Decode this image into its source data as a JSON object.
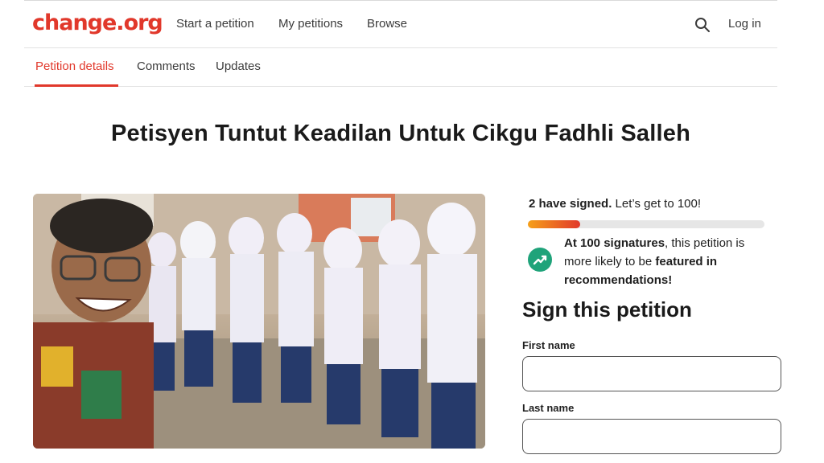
{
  "header": {
    "logo": "change.org",
    "nav": [
      "Start a petition",
      "My petitions",
      "Browse"
    ],
    "login": "Log in"
  },
  "tabs": {
    "items": [
      "Petition details",
      "Comments",
      "Updates"
    ],
    "active": "Petition details"
  },
  "petition": {
    "title": "Petisyen Tuntut Keadilan Untuk Cikgu Fadhli Salleh"
  },
  "signatures": {
    "count_text": "2 have signed.",
    "goal_text": "Let’s get to 100!",
    "progress_fraction": 0.22,
    "feature_bold_1": "At 100 signatures",
    "feature_text_1": ", this petition is more likely to be ",
    "feature_bold_2": "featured in recommendations!"
  },
  "form": {
    "heading": "Sign this petition",
    "first_name_label": "First name",
    "first_name_value": "",
    "last_name_label": "Last name",
    "last_name_value": ""
  },
  "colors": {
    "brand": "#e1382b",
    "progress_start": "#f6a019",
    "accent_green": "#1fa37a"
  },
  "icons": {
    "search": "search-icon",
    "trend": "trending-up-icon"
  }
}
